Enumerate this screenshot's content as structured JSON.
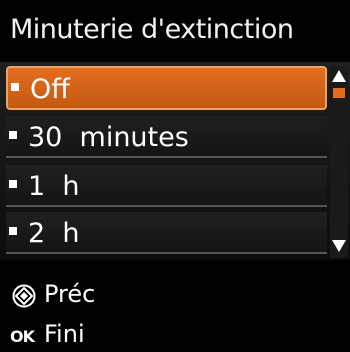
{
  "header": {
    "title": "Minuterie d'extinction"
  },
  "menu": {
    "items": [
      {
        "label": "Off",
        "selected": true
      },
      {
        "label": "30  minutes",
        "selected": false
      },
      {
        "label": "1  h",
        "selected": false
      },
      {
        "label": "2  h",
        "selected": false
      }
    ],
    "scroll_position": 0
  },
  "footer": {
    "back_label": "Préc",
    "back_icon": "stop-diamond-icon",
    "done_label": "Fini",
    "done_icon_text": "OK"
  },
  "colors": {
    "accent": "#e36d1f",
    "background": "#000000",
    "text": "#ffffff"
  }
}
